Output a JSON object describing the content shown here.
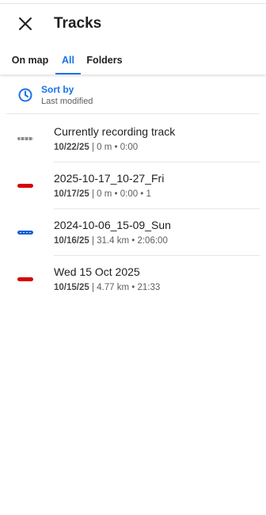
{
  "header": {
    "title": "Tracks",
    "close_icon": "close-icon"
  },
  "tabs": [
    {
      "label": "On map",
      "active": false
    },
    {
      "label": "All",
      "active": true
    },
    {
      "label": "Folders",
      "active": false
    }
  ],
  "sort": {
    "title": "Sort by",
    "value": "Last modified",
    "icon": "clock-icon"
  },
  "tracks": [
    {
      "name": "Currently recording track",
      "date": "10/22/25",
      "details": " | 0 m • 0:00",
      "line_style": "gray-dashed"
    },
    {
      "name": "2025-10-17_10-27_Fri",
      "date": "10/17/25",
      "details": " | 0 m • 0:00 • 1",
      "line_style": "red"
    },
    {
      "name": "2024-10-06_15-09_Sun",
      "date": "10/16/25",
      "details": " | 31.4 km • 2:06:00",
      "line_style": "blue-dashed"
    },
    {
      "name": "Wed 15 Oct 2025",
      "date": "10/15/25",
      "details": " | 4.77 km • 21:33",
      "line_style": "red"
    }
  ],
  "colors": {
    "accent": "#1a73e8",
    "red_track": "#d60000",
    "blue_track": "#1a5fd0"
  }
}
